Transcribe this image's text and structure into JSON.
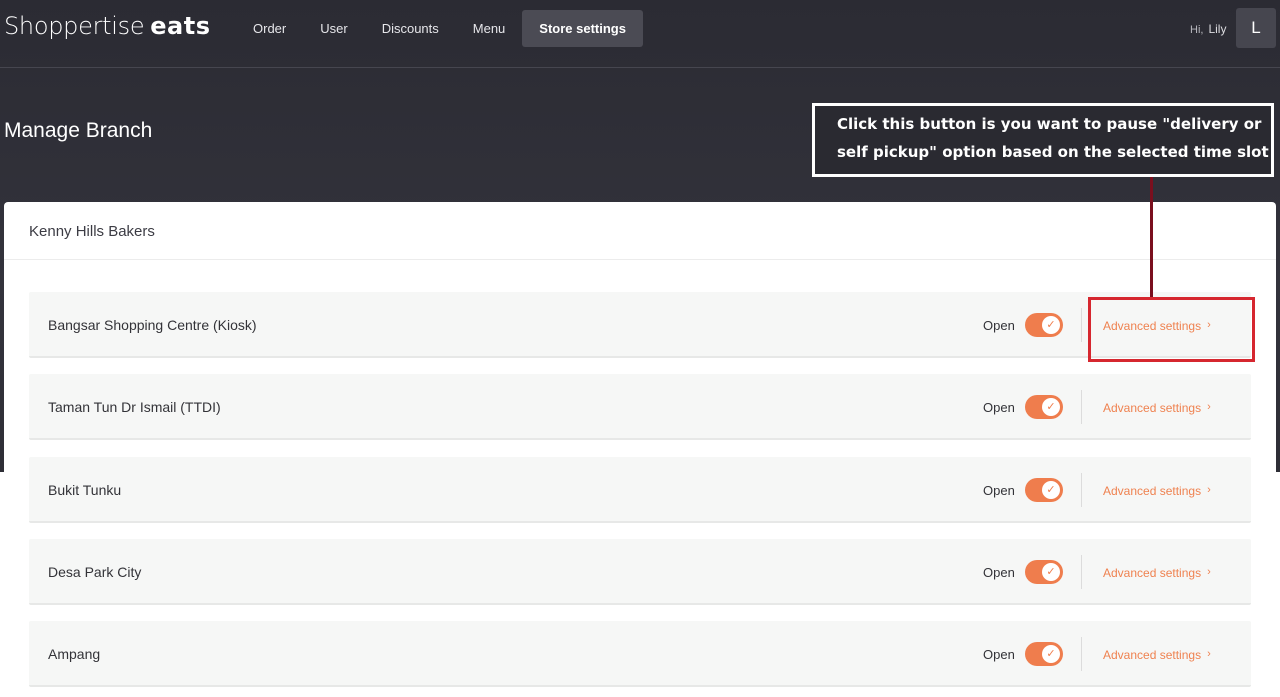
{
  "app": {
    "logo_main": "Shoppertise",
    "logo_accent": "eats"
  },
  "nav": {
    "items": [
      {
        "label": "Order"
      },
      {
        "label": "User"
      },
      {
        "label": "Discounts"
      },
      {
        "label": "Menu"
      },
      {
        "label": "Store settings",
        "active": true
      }
    ]
  },
  "user": {
    "greeting": "Hi,",
    "name": "Lily",
    "avatar_initial": "L"
  },
  "page": {
    "title": "Manage Branch"
  },
  "annotation": {
    "text": "Click this button is you want to pause \"delivery or self pickup\" option based on the selected time slot"
  },
  "store": {
    "name": "Kenny Hills Bakers",
    "branches": [
      {
        "name": "Bangsar Shopping Centre (Kiosk)",
        "status": "Open",
        "is_open": true,
        "link": "Advanced settings"
      },
      {
        "name": "Taman Tun Dr Ismail (TTDI)",
        "status": "Open",
        "is_open": true,
        "link": "Advanced settings"
      },
      {
        "name": "Bukit Tunku",
        "status": "Open",
        "is_open": true,
        "link": "Advanced settings"
      },
      {
        "name": "Desa Park City",
        "status": "Open",
        "is_open": true,
        "link": "Advanced settings"
      },
      {
        "name": "Ampang",
        "status": "Open",
        "is_open": true,
        "link": "Advanced settings"
      }
    ]
  },
  "colors": {
    "accent": "#ef7d4d",
    "header_bg": "#2b2b33",
    "highlight_border": "#d6272f",
    "connector": "#7a0f1e"
  }
}
